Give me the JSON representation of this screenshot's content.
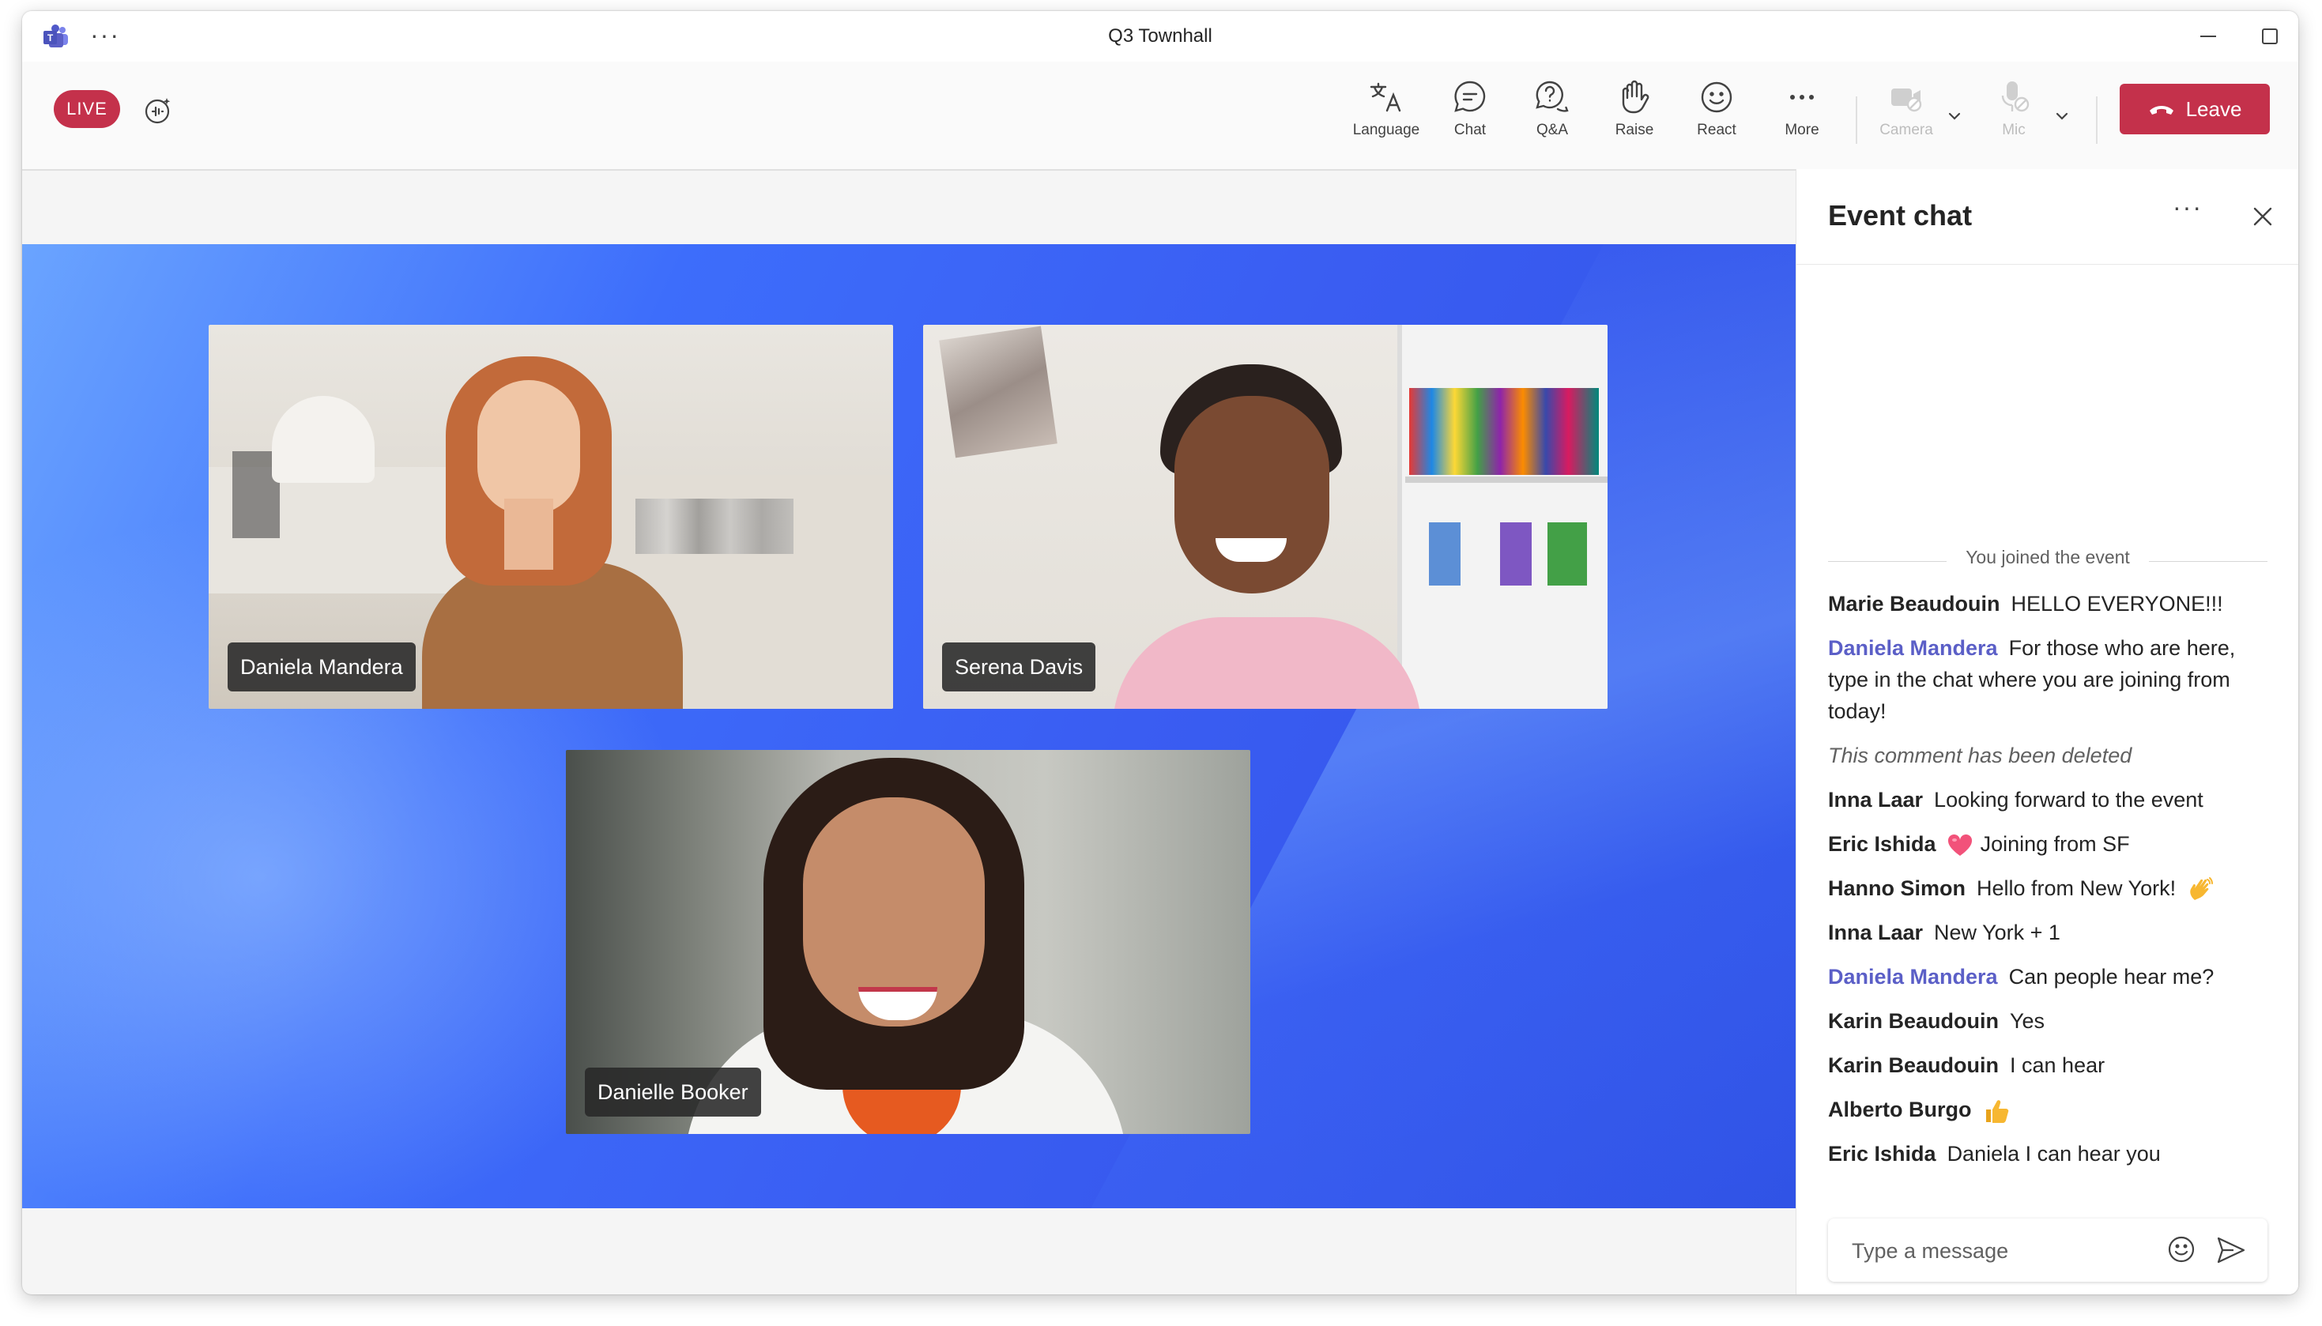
{
  "window": {
    "title": "Q3 Townhall"
  },
  "toolbar": {
    "live_label": "LIVE",
    "tools": [
      {
        "id": "language",
        "label": "Language"
      },
      {
        "id": "chat",
        "label": "Chat"
      },
      {
        "id": "qa",
        "label": "Q&A"
      },
      {
        "id": "raise",
        "label": "Raise"
      },
      {
        "id": "react",
        "label": "React"
      },
      {
        "id": "more",
        "label": "More"
      },
      {
        "id": "camera",
        "label": "Camera"
      },
      {
        "id": "mic",
        "label": "Mic"
      }
    ],
    "leave_label": "Leave"
  },
  "participants": [
    {
      "name": "Daniela Mandera"
    },
    {
      "name": "Serena Davis"
    },
    {
      "name": "Danielle Booker"
    }
  ],
  "chat": {
    "title": "Event chat",
    "joined_notice": "You joined the event",
    "messages": [
      {
        "author": "Marie Beaudouin",
        "text": "HELLO EVERYONE!!!"
      },
      {
        "author": "Daniela Mandera",
        "text": "For those who are here, type in the chat where you are joining from today!",
        "moderator": true
      },
      {
        "author": "",
        "text": "This comment has been deleted",
        "deleted": true
      },
      {
        "author": "Inna Laar",
        "text": "Looking forward to the event"
      },
      {
        "author": "Eric Ishida",
        "text": "Joining from SF",
        "emoji_before": "heart"
      },
      {
        "author": "Hanno Simon",
        "text": "Hello from New York!",
        "emoji_after": "wave"
      },
      {
        "author": "Inna Laar",
        "text": "New York + 1"
      },
      {
        "author": "Daniela Mandera",
        "text": "Can people hear me?",
        "moderator": true
      },
      {
        "author": "Karin Beaudouin",
        "text": "Yes"
      },
      {
        "author": "Karin Beaudouin",
        "text": "I can hear"
      },
      {
        "author": "Alberto Burgo",
        "text": "",
        "emoji_before": "thumbs-up"
      },
      {
        "author": "Eric Ishida",
        "text": "Daniela I can hear you"
      }
    ],
    "composer": {
      "placeholder": "Type a message"
    }
  },
  "colors": {
    "accent": "#5b5fc7",
    "live": "#c4314b",
    "leave": "#c4314b",
    "stage": "#3d6dfb"
  }
}
